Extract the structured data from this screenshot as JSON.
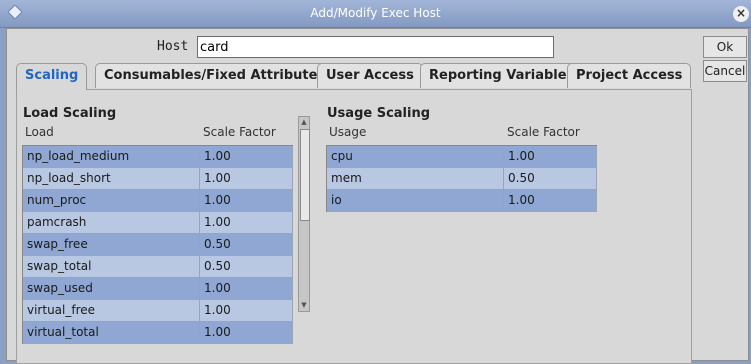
{
  "window": {
    "title": "Add/Modify Exec Host"
  },
  "host": {
    "label": "Host",
    "value": "card"
  },
  "buttons": {
    "ok": "Ok",
    "cancel": "Cancel"
  },
  "tabs": [
    {
      "label": "Scaling",
      "active": true
    },
    {
      "label": "Consumables/Fixed Attributes"
    },
    {
      "label": "User Access"
    },
    {
      "label": "Reporting Variables"
    },
    {
      "label": "Project Access"
    }
  ],
  "load_scaling": {
    "title": "Load Scaling",
    "columns": [
      "Load",
      "Scale Factor"
    ],
    "rows": [
      {
        "name": "np_load_medium",
        "factor": "1.00",
        "selected": true
      },
      {
        "name": "np_load_short",
        "factor": "1.00",
        "selected": false
      },
      {
        "name": "num_proc",
        "factor": "1.00",
        "selected": true
      },
      {
        "name": "pamcrash",
        "factor": "1.00",
        "selected": false
      },
      {
        "name": "swap_free",
        "factor": "0.50",
        "selected": true
      },
      {
        "name": "swap_total",
        "factor": "0.50",
        "selected": false
      },
      {
        "name": "swap_used",
        "factor": "1.00",
        "selected": true
      },
      {
        "name": "virtual_free",
        "factor": "1.00",
        "selected": false
      },
      {
        "name": "virtual_total",
        "factor": "1.00",
        "selected": true
      }
    ]
  },
  "usage_scaling": {
    "title": "Usage Scaling",
    "columns": [
      "Usage",
      "Scale Factor"
    ],
    "rows": [
      {
        "name": "cpu",
        "factor": "1.00",
        "selected": true
      },
      {
        "name": "mem",
        "factor": "0.50",
        "selected": false
      },
      {
        "name": "io",
        "factor": "1.00",
        "selected": true
      }
    ]
  },
  "icons": {
    "window": "diamond-icon",
    "close": "close-icon"
  },
  "colors": {
    "titlebar": "#8399c2",
    "selected_row": "#8fa7d2",
    "active_tab_text": "#1f66c8"
  }
}
